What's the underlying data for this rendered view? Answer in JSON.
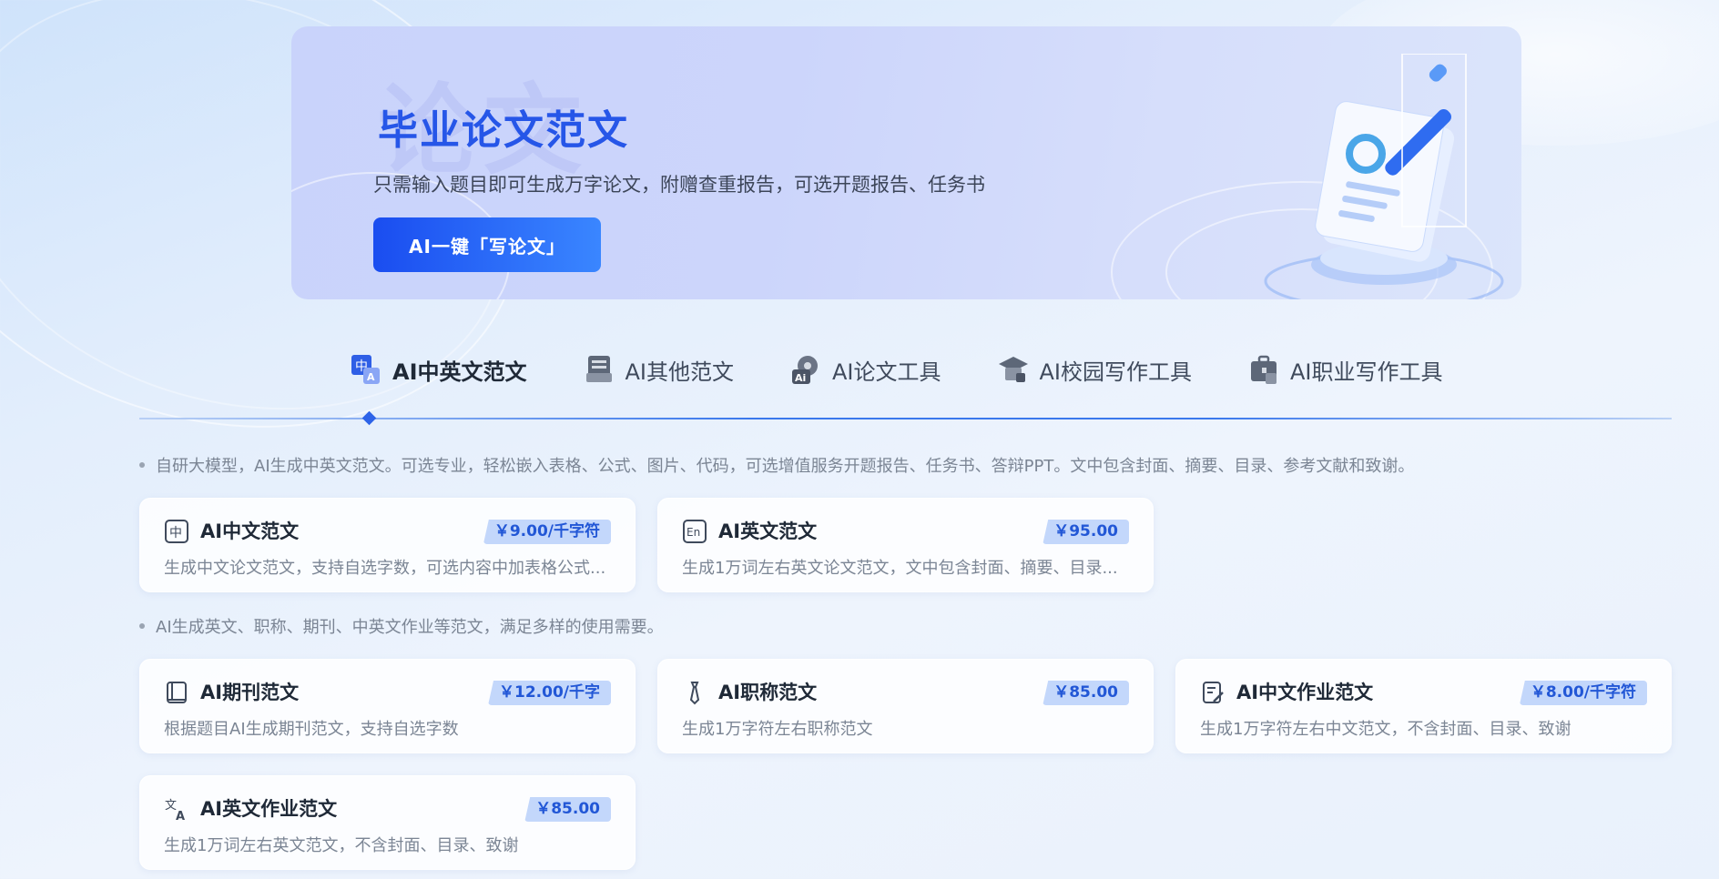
{
  "banner": {
    "watermark": "论文",
    "title": "毕业论文范文",
    "subtitle": "只需输入题目即可生成万字论文，附赠查重报告，可选开题报告、任务书",
    "button_label": "AI一键「写论文」"
  },
  "tabs": [
    {
      "label": "AI中英文范文",
      "icon": "zh-en-icon",
      "active": true
    },
    {
      "label": "AI其他范文",
      "icon": "document-stack-icon",
      "active": false
    },
    {
      "label": "AI论文工具",
      "icon": "ai-gear-icon",
      "active": false
    },
    {
      "label": "AI校园写作工具",
      "icon": "graduation-cap-icon",
      "active": false
    },
    {
      "label": "AI职业写作工具",
      "icon": "briefcase-icon",
      "active": false
    }
  ],
  "sections": [
    {
      "note": "自研大模型，AI生成中英文范文。可选专业，轻松嵌入表格、公式、图片、代码，可选增值服务开题报告、任务书、答辩PPT。文中包含封面、摘要、目录、参考文献和致谢。",
      "cards": [
        {
          "title": "AI中文范文",
          "price": "￥9.00/千字符",
          "desc": "生成中文论文范文，支持自选字数，可选内容中加表格公式...",
          "icon": "zh-icon"
        },
        {
          "title": "AI英文范文",
          "price": "￥95.00",
          "desc": "生成1万词左右英文论文范文，文中包含封面、摘要、目录...",
          "icon": "en-icon"
        }
      ]
    },
    {
      "note": "AI生成英文、职称、期刊、中英文作业等范文，满足多样的使用需要。",
      "cards": [
        {
          "title": "AI期刊范文",
          "price": "￥12.00/千字",
          "desc": "根据题目AI生成期刊范文，支持自选字数",
          "icon": "book-icon"
        },
        {
          "title": "AI职称范文",
          "price": "￥85.00",
          "desc": "生成1万字符左右职称范文",
          "icon": "tie-icon"
        },
        {
          "title": "AI中文作业范文",
          "price": "￥8.00/千字符",
          "desc": "生成1万字符左右中文范文，不含封面、目录、致谢",
          "icon": "edit-doc-icon"
        },
        {
          "title": "AI英文作业范文",
          "price": "￥85.00",
          "desc": "生成1万词左右英文范文，不含封面、目录、致谢",
          "icon": "translate-icon"
        }
      ]
    }
  ],
  "colors": {
    "accent": "#2656e8",
    "price_bg": "#c3d7fb",
    "price_text": "#2257d6"
  }
}
